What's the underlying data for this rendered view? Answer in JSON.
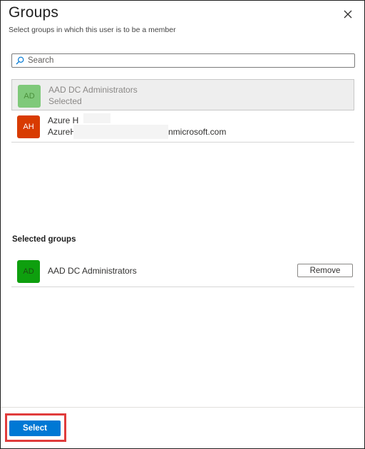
{
  "panel": {
    "title": "Groups",
    "subtitle": "Select groups in which this user is to be a member"
  },
  "search": {
    "placeholder": "Search"
  },
  "results": [
    {
      "initials": "AD",
      "name": "AAD DC Administrators",
      "detail": "Selected",
      "avatar_color": "#7fc97a",
      "state": "selected"
    },
    {
      "initials": "AH",
      "name": "Azure H",
      "detail_prefix": "AzureH",
      "detail_suffix": "nmicrosoft.com",
      "avatar_color": "#d83b01",
      "state": "available"
    }
  ],
  "selected_section": {
    "label": "Selected groups",
    "items": [
      {
        "initials": "AD",
        "name": "AAD DC Administrators",
        "avatar_color": "#0e9f0e",
        "remove_label": "Remove"
      }
    ]
  },
  "footer": {
    "select_label": "Select",
    "highlight_color": "#e03c3c",
    "accent_color": "#0078d4"
  }
}
